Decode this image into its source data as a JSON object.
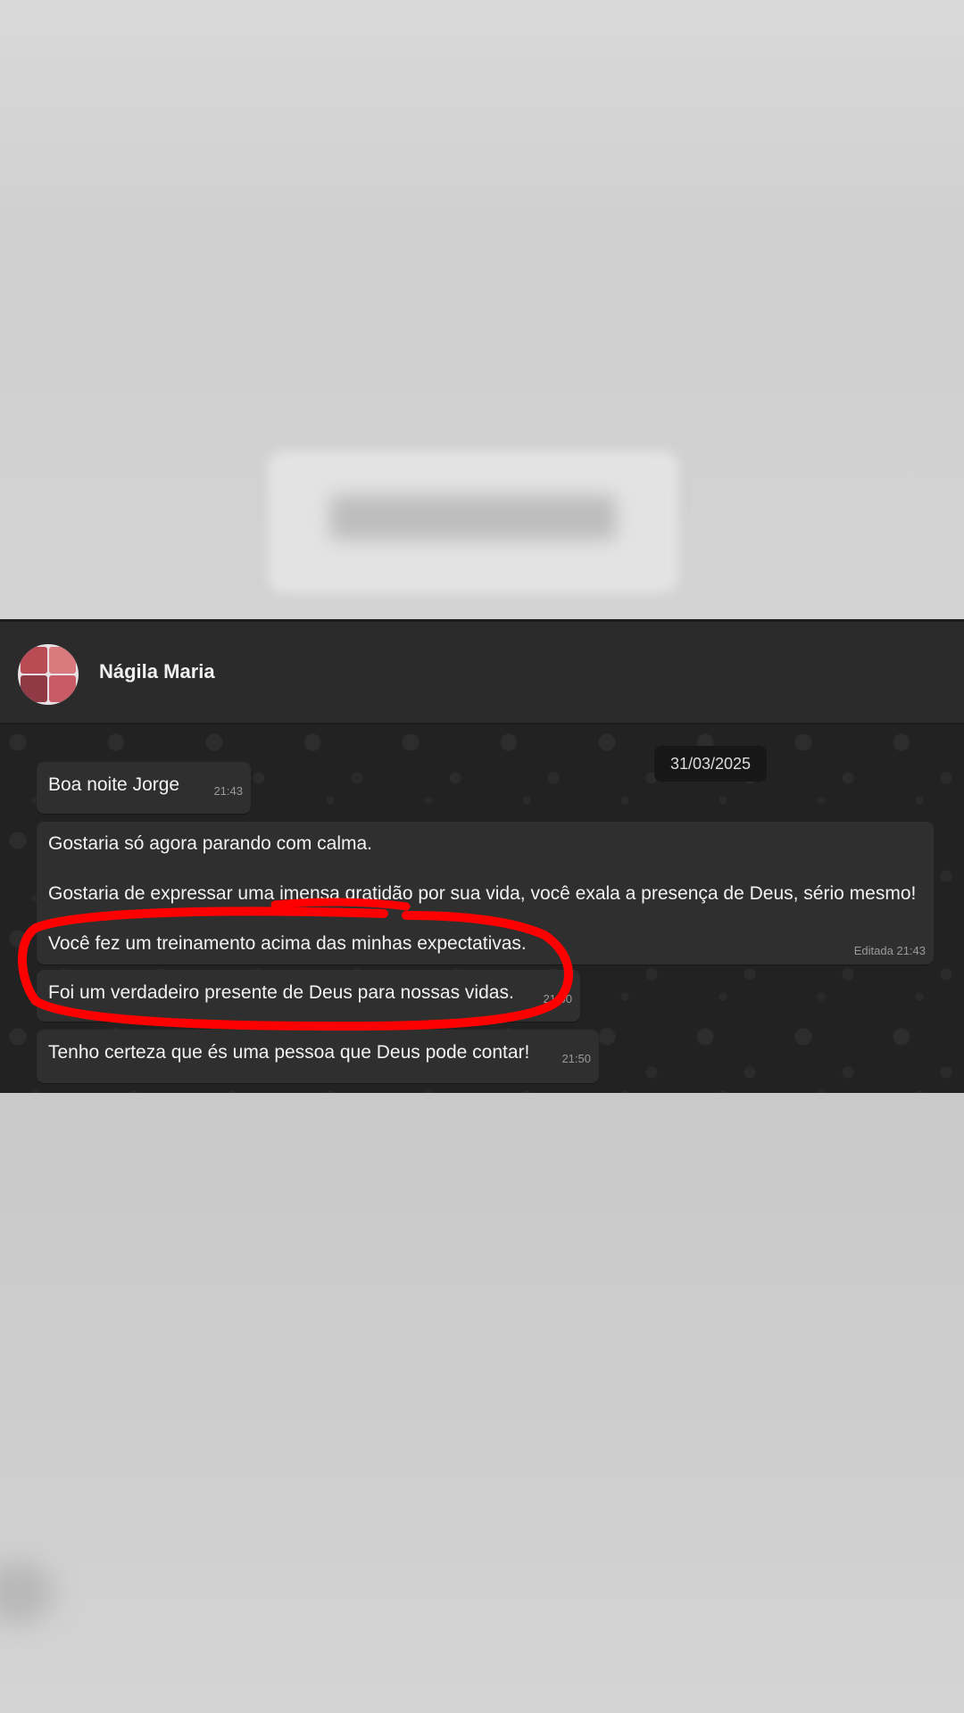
{
  "contact": {
    "name": "Nágila Maria"
  },
  "date_chip": "31/03/2025",
  "messages": [
    {
      "text": "Boa noite Jorge",
      "time": "21:43"
    },
    {
      "line1": "Gostaria só agora parando com calma.",
      "line2": "Gostaria de expressar uma imensa gratidão por sua vida, você exala a presença de Deus, sério mesmo!",
      "line3": "Você fez um treinamento acima das minhas expectativas.",
      "time": "Editada 21:43"
    },
    {
      "text": "Foi um verdadeiro presente de Deus para nossas vidas.",
      "time": "21:50"
    },
    {
      "text": "Tenho certeza que és uma pessoa que Deus pode contar!",
      "time": "21:50"
    }
  ],
  "colors": {
    "header_bg": "#2b2b2b",
    "chat_bg": "#222222",
    "bubble_bg": "#2f2f2f",
    "annotation": "#ff0000"
  }
}
